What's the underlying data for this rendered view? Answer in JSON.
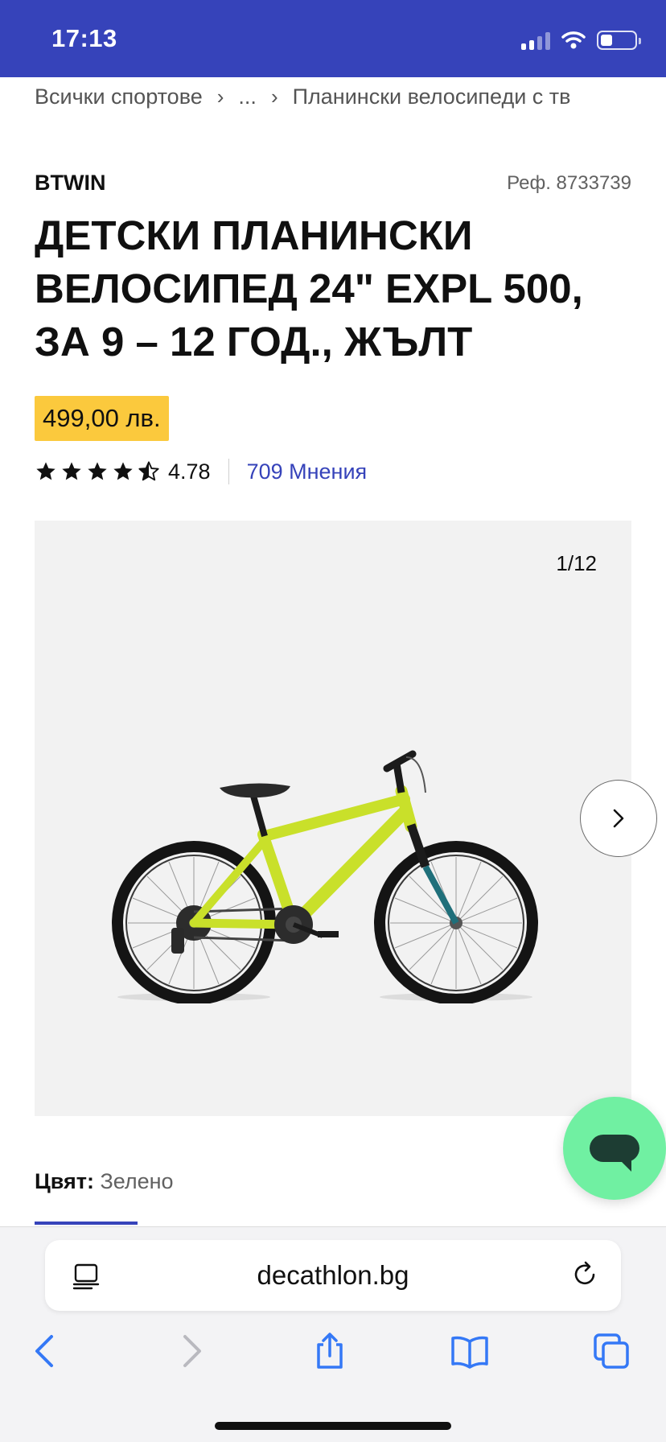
{
  "status_bar": {
    "time": "17:13"
  },
  "breadcrumb": {
    "items": [
      "Всички спортове",
      "...",
      "Планински велосипеди с тв"
    ]
  },
  "product": {
    "brand": "BTWIN",
    "ref": "Реф. 8733739",
    "title_lines": [
      "ДЕТСКИ ПЛАНИНСКИ",
      "ВЕЛОСИПЕД 24\" EXPL 500,",
      "ЗА 9 – 12 ГОД., ЖЪЛТ"
    ],
    "price": "499,00 лв.",
    "rating_value": "4.78",
    "stars": 4.78,
    "reviews": "709 Мнения"
  },
  "gallery": {
    "counter": "1/12",
    "image": "yellow kids mountain bike"
  },
  "color": {
    "label": "Цвят:",
    "value": "Зелено"
  },
  "browser": {
    "url": "decathlon.bg"
  },
  "colors": {
    "brand_blue": "#3643ba",
    "price_yellow": "#fbc93d",
    "chat_green": "#70f0a2"
  },
  "icons": [
    "signal-icon",
    "wifi-icon",
    "battery-icon",
    "chevron-right-icon",
    "star-icon",
    "chat-icon",
    "reader-icon",
    "reload-icon",
    "back-icon",
    "forward-icon",
    "share-icon",
    "bookmarks-icon",
    "tabs-icon"
  ]
}
